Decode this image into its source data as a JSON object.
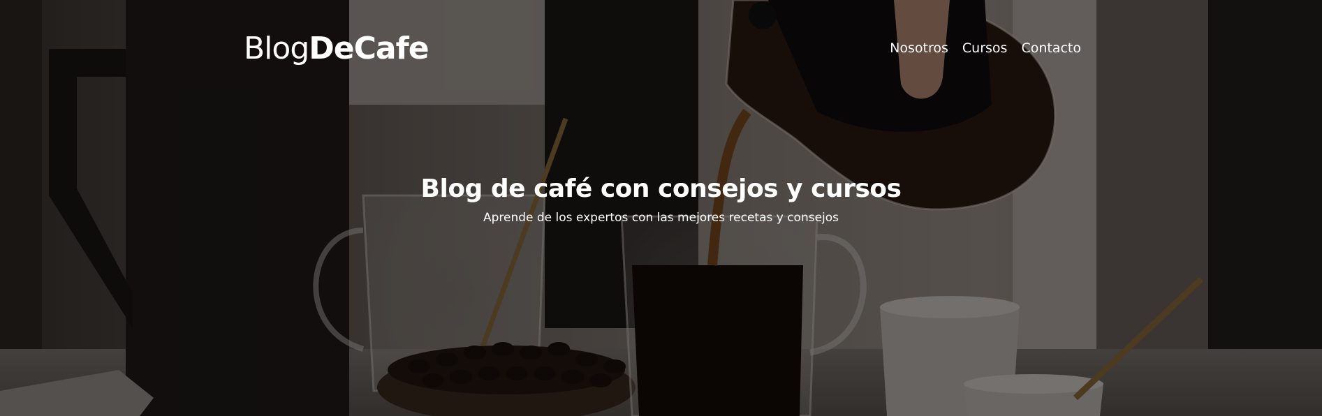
{
  "header": {
    "logo_light": "Blog",
    "logo_bold": "DeCafe",
    "nav": [
      {
        "label": "Nosotros"
      },
      {
        "label": "Cursos"
      },
      {
        "label": "Contacto"
      }
    ]
  },
  "hero": {
    "title": "Blog de café con consejos y cursos",
    "subtitle": "Aprende de los expertos con las mejores recetas y consejos"
  },
  "colors": {
    "overlay": "#000000",
    "text": "#ffffff",
    "coffee": "#2a1a12"
  }
}
